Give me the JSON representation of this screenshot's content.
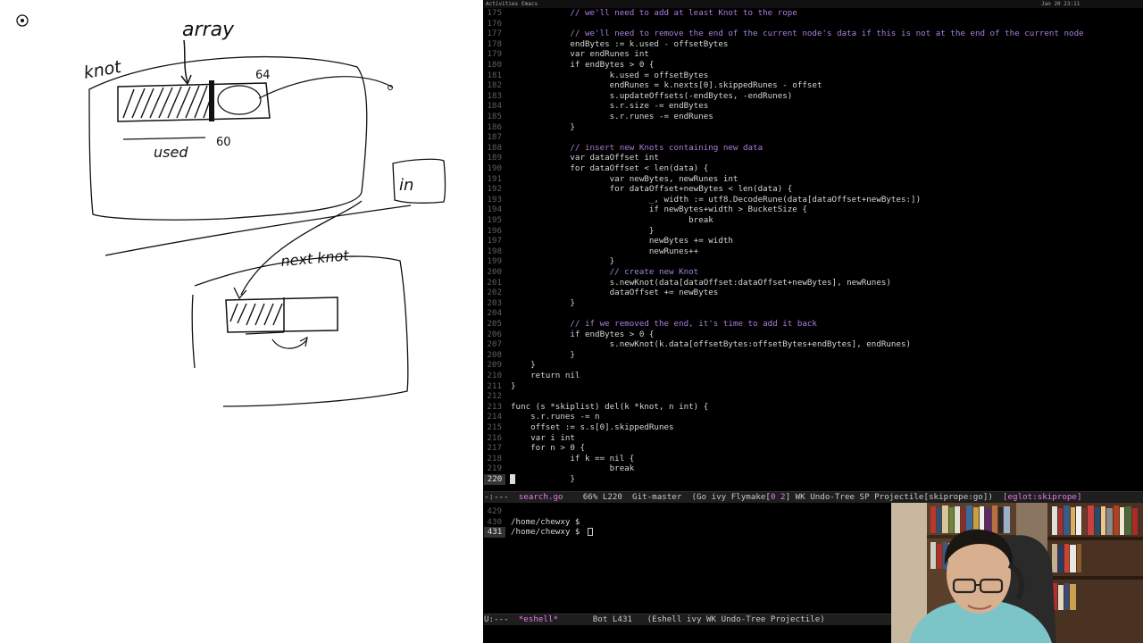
{
  "topbar": {
    "activities": "Activities",
    "app": "Emacs",
    "clock": "Jan 20  23:11"
  },
  "whiteboard": {
    "labels": {
      "array": "array",
      "knot": "knot",
      "n64": "64",
      "used": "used",
      "n60": "60",
      "in": "in",
      "next_knot": "next knot"
    }
  },
  "code": {
    "cursor_line": "220",
    "lines": [
      {
        "n": "175",
        "t": "            // we'll need to add at least Knot to the rope",
        "c": "cmt"
      },
      {
        "n": "176",
        "t": "",
        "c": ""
      },
      {
        "n": "177",
        "t": "            // we'll need to remove the end of the current node's data if this is not at the end of the current node",
        "c": "cmt"
      },
      {
        "n": "178",
        "t": "            endBytes := k.used - offsetBytes",
        "c": ""
      },
      {
        "n": "179",
        "t": "            var endRunes int",
        "c": ""
      },
      {
        "n": "180",
        "t": "            if endBytes > 0 {",
        "c": ""
      },
      {
        "n": "181",
        "t": "                    k.used = offsetBytes",
        "c": ""
      },
      {
        "n": "182",
        "t": "                    endRunes = k.nexts[0].skippedRunes - offset",
        "c": ""
      },
      {
        "n": "183",
        "t": "                    s.updateOffsets(-endBytes, -endRunes)",
        "c": ""
      },
      {
        "n": "184",
        "t": "                    s.r.size -= endBytes",
        "c": ""
      },
      {
        "n": "185",
        "t": "                    s.r.runes -= endRunes",
        "c": ""
      },
      {
        "n": "186",
        "t": "            }",
        "c": ""
      },
      {
        "n": "187",
        "t": "",
        "c": ""
      },
      {
        "n": "188",
        "t": "            // insert new Knots containing new data",
        "c": "cmt"
      },
      {
        "n": "189",
        "t": "            var dataOffset int",
        "c": ""
      },
      {
        "n": "190",
        "t": "            for dataOffset < len(data) {",
        "c": ""
      },
      {
        "n": "191",
        "t": "                    var newBytes, newRunes int",
        "c": ""
      },
      {
        "n": "192",
        "t": "                    for dataOffset+newBytes < len(data) {",
        "c": ""
      },
      {
        "n": "193",
        "t": "                            _, width := utf8.DecodeRune(data[dataOffset+newBytes:])",
        "c": ""
      },
      {
        "n": "194",
        "t": "                            if newBytes+width > BucketSize {",
        "c": ""
      },
      {
        "n": "195",
        "t": "                                    break",
        "c": ""
      },
      {
        "n": "196",
        "t": "                            }",
        "c": ""
      },
      {
        "n": "197",
        "t": "                            newBytes += width",
        "c": ""
      },
      {
        "n": "198",
        "t": "                            newRunes++",
        "c": ""
      },
      {
        "n": "199",
        "t": "                    }",
        "c": ""
      },
      {
        "n": "200",
        "t": "                    // create new Knot",
        "c": "cmt"
      },
      {
        "n": "201",
        "t": "                    s.newKnot(data[dataOffset:dataOffset+newBytes], newRunes)",
        "c": ""
      },
      {
        "n": "202",
        "t": "                    dataOffset += newBytes",
        "c": ""
      },
      {
        "n": "203",
        "t": "            }",
        "c": ""
      },
      {
        "n": "204",
        "t": "",
        "c": ""
      },
      {
        "n": "205",
        "t": "            // if we removed the end, it's time to add it back",
        "c": "cmt"
      },
      {
        "n": "206",
        "t": "            if endBytes > 0 {",
        "c": ""
      },
      {
        "n": "207",
        "t": "                    s.newKnot(k.data[offsetBytes:offsetBytes+endBytes], endRunes)",
        "c": ""
      },
      {
        "n": "208",
        "t": "            }",
        "c": ""
      },
      {
        "n": "209",
        "t": "    }",
        "c": ""
      },
      {
        "n": "210",
        "t": "    return nil",
        "c": ""
      },
      {
        "n": "211",
        "t": "}",
        "c": ""
      },
      {
        "n": "212",
        "t": "",
        "c": ""
      },
      {
        "n": "213",
        "t": "func (s *skiplist) del(k *knot, n int) {",
        "c": ""
      },
      {
        "n": "214",
        "t": "    s.r.runes -= n",
        "c": ""
      },
      {
        "n": "215",
        "t": "    offset := s.s[0].skippedRunes",
        "c": ""
      },
      {
        "n": "216",
        "t": "    var i int",
        "c": ""
      },
      {
        "n": "217",
        "t": "    for n > 0 {",
        "c": ""
      },
      {
        "n": "218",
        "t": "            if k == nil {",
        "c": ""
      },
      {
        "n": "219",
        "t": "                    break",
        "c": ""
      },
      {
        "n": "220",
        "t": "            }",
        "c": ""
      }
    ]
  },
  "modeline_code": {
    "state": "-:---",
    "buffer": "search.go",
    "position": "66% L220",
    "branch": "Git-master",
    "modes": "(Go ivy Flymake[",
    "flymake": "0 2",
    "modes_rest": "] WK Undo-Tree SP Projectile[skiprope:go])",
    "eglot": "[eglot:skiprope]"
  },
  "shell": {
    "lines": [
      {
        "n": "429",
        "t": ""
      },
      {
        "n": "430",
        "t": "/home/chewxy $"
      },
      {
        "n": "431",
        "t": "/home/chewxy $"
      }
    ]
  },
  "modeline_shell": {
    "state": "U:---",
    "buffer": "*eshell*",
    "position": "Bot L431",
    "modes": "(Eshell ivy WK Undo-Tree Projectile)"
  },
  "colors": {
    "comment": "#a97fdc",
    "accent": "#e77ae7",
    "background": "#000000"
  }
}
